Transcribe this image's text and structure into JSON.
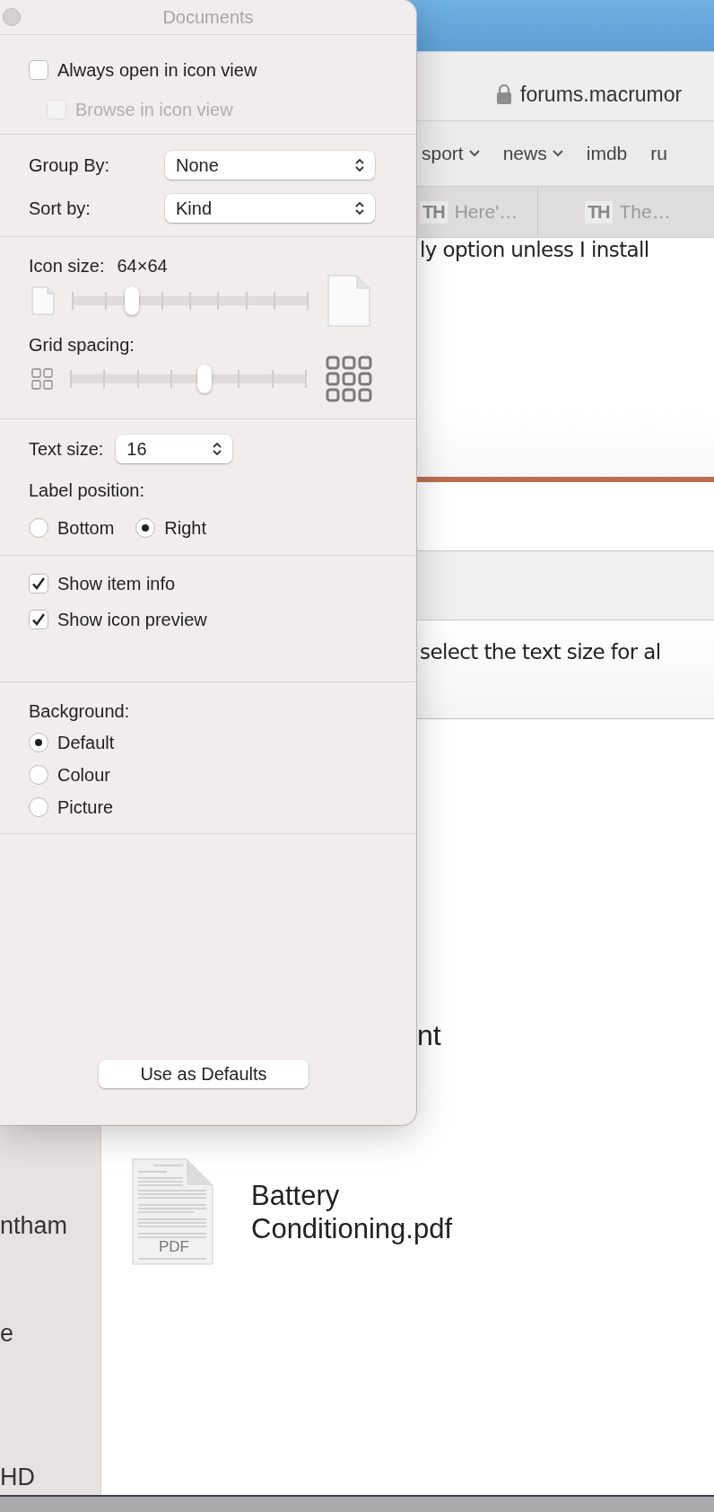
{
  "panel": {
    "title": "Documents",
    "options": [
      {
        "label": "Always open in icon view",
        "checked": false,
        "disabled": false
      },
      {
        "label": "Browse in icon view",
        "checked": false,
        "disabled": true
      }
    ],
    "group_by": {
      "label": "Group By:",
      "value": "None"
    },
    "sort_by": {
      "label": "Sort by:",
      "value": "Kind"
    },
    "icon_size": {
      "label": "Icon size:",
      "reading": "64×64",
      "level": 0.25
    },
    "grid_spacing": {
      "label": "Grid spacing:",
      "level": 0.57
    },
    "text_size": {
      "label": "Text size:",
      "value": "16"
    },
    "label_position": {
      "label": "Label position:",
      "options": [
        {
          "label": "Bottom",
          "selected": false
        },
        {
          "label": "Right",
          "selected": true
        }
      ]
    },
    "show_options": [
      {
        "label": "Show item info",
        "checked": true
      },
      {
        "label": "Show icon preview",
        "checked": true
      }
    ],
    "background": {
      "label": "Background:",
      "options": [
        {
          "label": "Default",
          "selected": true
        },
        {
          "label": "Colour",
          "selected": false
        },
        {
          "label": "Picture",
          "selected": false
        }
      ]
    },
    "button": "Use as Defaults"
  },
  "browser": {
    "address": "forums.macrumor",
    "bookmarks": [
      {
        "label": "sport",
        "menu": true
      },
      {
        "label": "news",
        "menu": true
      },
      {
        "label": "imdb",
        "menu": false
      },
      {
        "label": "ru",
        "menu": false
      }
    ],
    "tabs": [
      {
        "favicon": "TH",
        "title": "Here'…",
        "selected": false
      },
      {
        "favicon": "TH",
        "title": "The…",
        "selected": false
      }
    ],
    "content": [
      "ly option unless I install",
      "select the text size for al"
    ]
  },
  "finder": {
    "sidebar": [
      "ntham",
      "e",
      "HD"
    ],
    "items": [
      {
        "name": "nt"
      },
      {
        "name": "Battery Conditioning.pdf",
        "badge": "PDF"
      }
    ]
  }
}
